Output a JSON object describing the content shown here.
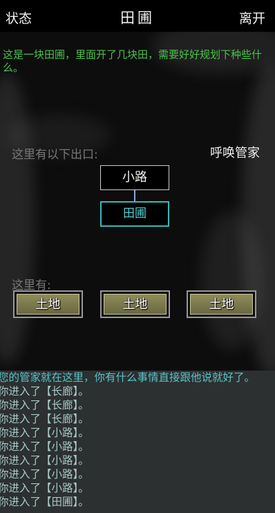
{
  "header": {
    "status_label": "状态",
    "title": "田圃",
    "leave_label": "离开"
  },
  "scene": {
    "description": "这是一块田圃，里面开了几块田，需要好好规划下种些什么。",
    "exits_label": "这里有以下出口:",
    "summon_label": "呼唤管家",
    "map": {
      "neighbor": "小路",
      "current": "田圃"
    },
    "here_label": "这里有:",
    "items": [
      "土地",
      "土地",
      "土地"
    ]
  },
  "log": [
    "您的管家就在这里，你有什么事情直接跟他说就好了。",
    "你进入了【长廊】。",
    "你进入了【长廊】。",
    "你进入了【长廊】。",
    "你进入了【小路】。",
    "你进入了【小路】。",
    "你进入了【小路】。",
    "你进入了【小路】。",
    "你进入了【小路】。",
    "你进入了【田圃】。"
  ],
  "colors": {
    "description": "#49c24a",
    "current_room": "#37b8bb",
    "log_first": "#57c2c6",
    "log_text": "#a8c7c7",
    "log_bg": "#2c3030"
  }
}
